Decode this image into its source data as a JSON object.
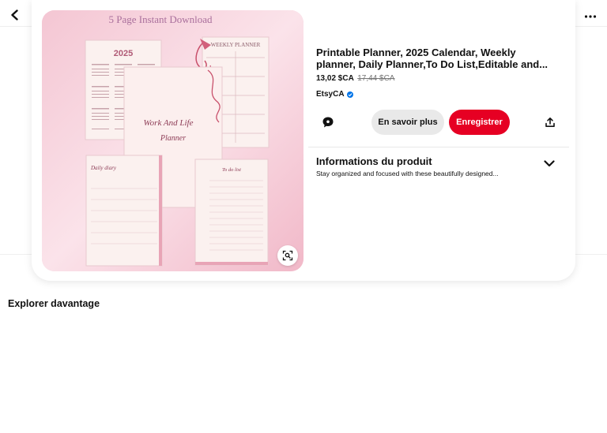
{
  "pin": {
    "image_caption": "5 Page Instant Download",
    "image_calendar_title": "2025",
    "image_weekly_title": "WEEKLY PLANNER",
    "image_cover_title_line1": "Work And Life",
    "image_cover_title_line2": "Planner",
    "image_daily_title": "Daily diary",
    "image_todo_title": "To do list",
    "title": "Printable Planner, 2025 Calendar, Weekly planner, Daily Planner,To Do List,Editable and...",
    "price": "13,02 $CA",
    "old_price": "17,44 $CA",
    "seller": "EtsyCA"
  },
  "actions": {
    "learn_more_label": "En savoir plus",
    "save_label": "Enregistrer"
  },
  "info": {
    "title": "Informations du produit",
    "description": "Stay organized and focused with these beautifully designed..."
  },
  "explore": {
    "heading": "Explorer davantage"
  },
  "colors": {
    "save_button": "#e60023",
    "verified_badge": "#0074e8",
    "image_background": "#f6d0db"
  },
  "icons": {
    "back": "back-arrow-icon",
    "more": "more-options-icon",
    "lens": "visual-search-icon",
    "comment": "comment-icon",
    "share": "share-icon",
    "expand": "chevron-down-icon",
    "verified": "verified-check-icon"
  }
}
